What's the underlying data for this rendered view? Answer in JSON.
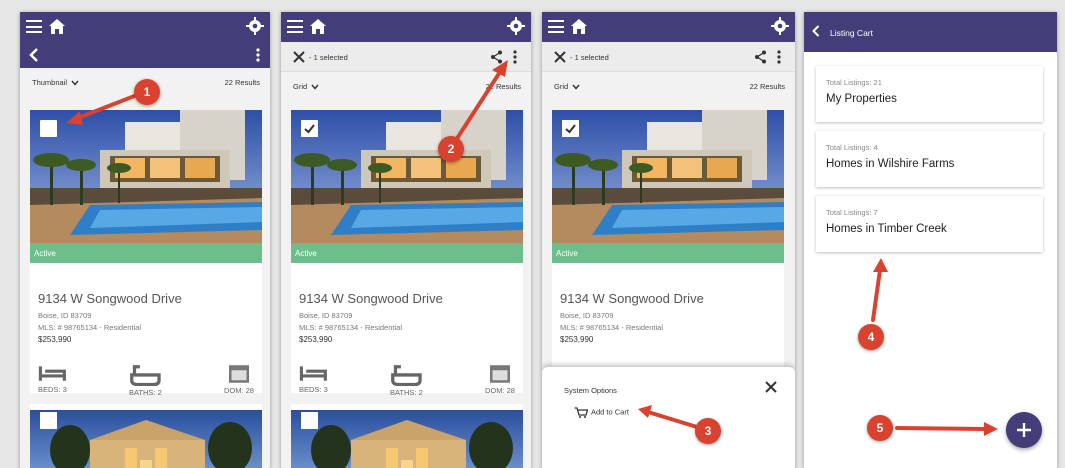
{
  "colors": {
    "primary": "#433d79",
    "active_badge": "#6cbf8b",
    "callout": "#d9422f"
  },
  "icons": [
    "menu-icon",
    "home-icon",
    "gear-icon",
    "back-icon",
    "more-icon",
    "close-icon",
    "share-icon",
    "chevron-down-icon",
    "checkbox-icon",
    "bed-icon",
    "bath-icon",
    "calendar-icon",
    "cart-icon",
    "plus-icon"
  ],
  "panel1": {
    "view_label": "Thumbnail",
    "results": "22 Results",
    "listing": {
      "status": "Active",
      "address": "9134 W Songwood Drive",
      "city": "Boise, ID 83709",
      "mls": "MLS: # 98765134 - Residential",
      "price": "$253,990",
      "beds": "BEDS: 3",
      "baths": "BATHS: 2",
      "dom": "DOM: 28"
    }
  },
  "panel2": {
    "selection": "- 1 selected",
    "view_label": "Grid",
    "results": "22 Results",
    "listing": {
      "status": "Active",
      "address": "9134 W Songwood Drive",
      "city": "Boise, ID 83709",
      "mls": "MLS: # 98765134 - Residential",
      "price": "$253,990",
      "beds": "BEDS: 3",
      "baths": "BATHS: 2",
      "dom": "DOM: 28"
    }
  },
  "panel3": {
    "selection": "- 1 selected",
    "view_label": "Grid",
    "results": "22 Results",
    "listing": {
      "status": "Active",
      "address": "9134 W Songwood Drive",
      "city": "Boise, ID 83709",
      "mls": "MLS: # 98765134 - Residential",
      "price": "$253,990"
    },
    "sheet": {
      "title": "System Options",
      "action": "Add to Cart"
    }
  },
  "panel4": {
    "header": "Listing Cart",
    "lists": [
      {
        "count": "Total Listings: 21",
        "name": "My Properties"
      },
      {
        "count": "Total Listings: 4",
        "name": "Homes in Wilshire Farms"
      },
      {
        "count": "Total Listings: 7",
        "name": "Homes in Timber Creek"
      }
    ]
  },
  "callouts": [
    "1",
    "2",
    "3",
    "4",
    "5"
  ]
}
